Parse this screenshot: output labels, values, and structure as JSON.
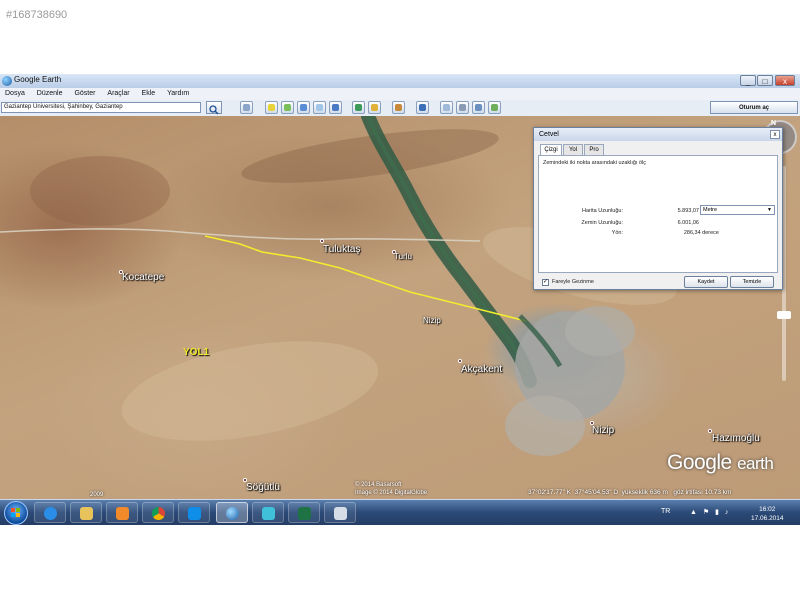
{
  "listing_id": "#168738690",
  "window": {
    "title": "Google Earth",
    "minimize": "_",
    "maximize": "□",
    "close": "x"
  },
  "menu": [
    "Dosya",
    "Düzenle",
    "Göster",
    "Araçlar",
    "Ekle",
    "Yardım"
  ],
  "search": {
    "value": "Gaziantep Üniversitesi, Şahinbey, Gaziantep"
  },
  "signin_label": "Oturum aç",
  "map": {
    "labels": {
      "kocatepe": "Kocatepe",
      "tuluktas": "Tuluktaş",
      "turlu": "Turlu",
      "nizip_river": "Nizip",
      "akcakent": "Akçakent",
      "nizip": "Nizip",
      "hazimoglu": "Hazımoğlu",
      "sogutlu": "Söğütlü",
      "road": "YOL1"
    },
    "credits_line1": "© 2014 Basarsoft",
    "credits_line2": "Image © 2014 DigitalGlobe",
    "year": "2009",
    "logo_word1": "Google",
    "logo_word2": "earth",
    "compass_n": "N",
    "status": {
      "lat": "37°02'17.77\" K",
      "lon": "37°45'04.53\" D",
      "elevation": "yükseklik  636 m",
      "eye_altitude": "göz irtifası   10.73 km"
    }
  },
  "ruler": {
    "title": "Cetvel",
    "close": "x",
    "tabs": [
      "Çizgi",
      "Yol",
      "Pro"
    ],
    "instruction": "Zemindeki iki nokta arasındaki uzaklığı ölç",
    "map_length_label": "Harita Uzunluğu:",
    "map_length_value": "5.893,07",
    "unit": "Metre",
    "ground_length_label": "Zemin Uzunluğu:",
    "ground_length_value": "6.001,06",
    "heading_label": "Yön:",
    "heading_value": "286,34 derece",
    "mouse_nav_label": "Fareyle Gezinme",
    "mouse_nav_checked": "✓",
    "save_label": "Kaydet",
    "clear_label": "Temizle"
  },
  "taskbar": {
    "lang": "TR",
    "tray_icons": "▲ ⚑ ▮ ♪",
    "time": "16:02",
    "date": "17.06.2014"
  },
  "colors": {
    "road": "#f2ec2e",
    "river": "#2f5a44",
    "titlebar": "#c9d7ea"
  }
}
